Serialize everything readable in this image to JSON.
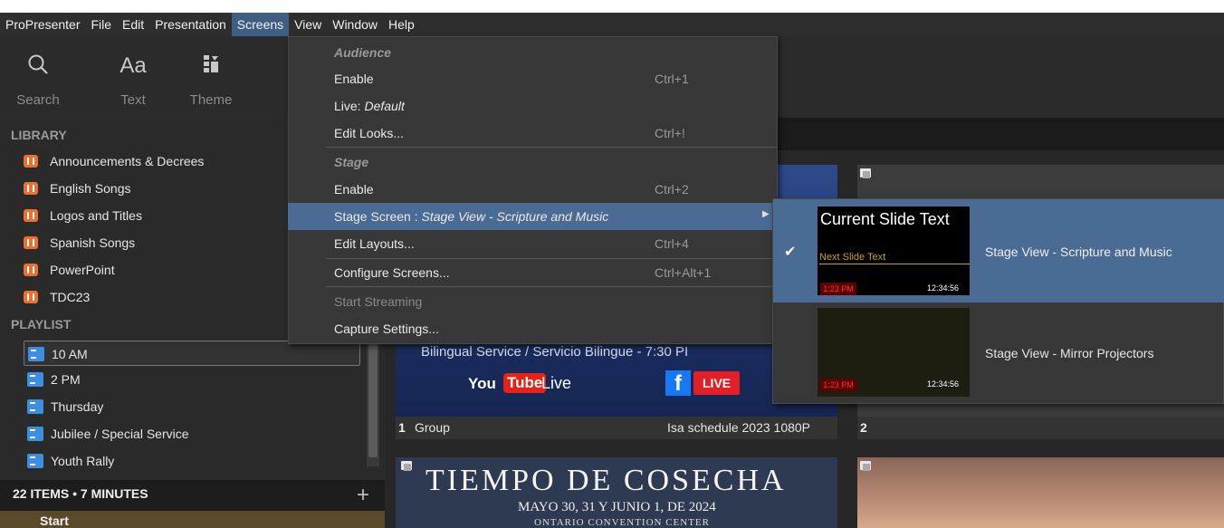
{
  "menubar": {
    "items": [
      "ProPresenter",
      "File",
      "Edit",
      "Presentation",
      "Screens",
      "View",
      "Window",
      "Help"
    ]
  },
  "toolbar": {
    "search_label": "Search",
    "text_label": "Text",
    "text_glyph": "Aa",
    "theme_label": "Theme"
  },
  "library": {
    "header": "LIBRARY",
    "items": [
      "Announcements & Decrees",
      "English Songs",
      "Logos and Titles",
      "Spanish Songs",
      "PowerPoint",
      "TDC23"
    ]
  },
  "playlist": {
    "header": "PLAYLIST",
    "items": [
      "10 AM",
      "2 PM",
      "Thursday",
      "Jubilee / Special Service",
      "Youth Rally"
    ],
    "selected_index": 0
  },
  "footer": {
    "summary": "22 ITEMS • 7 MINUTES",
    "add_symbol": "+",
    "start_label": "Start"
  },
  "slides": {
    "slide1": {
      "number": "1",
      "group": "Group",
      "title": "Isa schedule 2023 1080P",
      "subtitle_text": "Bilingual Service / Servicio Bilingue - 7:30 PI",
      "youtube_you": "You",
      "youtube_tube": "Tube",
      "youtube_live": "Live",
      "facebook_f": "f",
      "facebook_live": "LIVE"
    },
    "slide2": {
      "number": "2"
    },
    "slide3": {
      "title": "TIEMPO DE COSECHA",
      "date": "MAYO 30, 31 Y JUNIO 1, DE 2024",
      "venue": "ONTARIO CONVENTION CENTER"
    }
  },
  "screens_menu": {
    "audience_header": "Audience",
    "audience_enable": "Enable",
    "audience_enable_shortcut": "Ctrl+1",
    "live_prefix": "Live:",
    "live_value": "Default",
    "edit_looks": "Edit Looks...",
    "edit_looks_shortcut": "Ctrl+!",
    "stage_header": "Stage",
    "stage_enable": "Enable",
    "stage_enable_shortcut": "Ctrl+2",
    "stage_screen_prefix": "Stage Screen :",
    "stage_screen_value": "Stage View - Scripture and Music",
    "edit_layouts": "Edit Layouts...",
    "edit_layouts_shortcut": "Ctrl+4",
    "configure_screens": "Configure Screens...",
    "configure_screens_shortcut": "Ctrl+Alt+1",
    "start_streaming": "Start Streaming",
    "capture_settings": "Capture Settings..."
  },
  "stage_submenu": {
    "items": [
      {
        "label": "Stage View - Scripture and Music",
        "checked": true,
        "preview_current": "Current Slide Text",
        "preview_next": "Next Slide Text",
        "preview_red": "1:23 PM",
        "preview_time": "12:34:56"
      },
      {
        "label": "Stage View - Mirror Projectors",
        "checked": false,
        "preview_red": "1:23 PM",
        "preview_time": "12:34:56"
      }
    ]
  },
  "colors": {
    "highlight": "#4a6b93",
    "library_icon": "#e9722f",
    "playlist_icon": "#3b8fe0",
    "menu_bg": "#373737"
  }
}
